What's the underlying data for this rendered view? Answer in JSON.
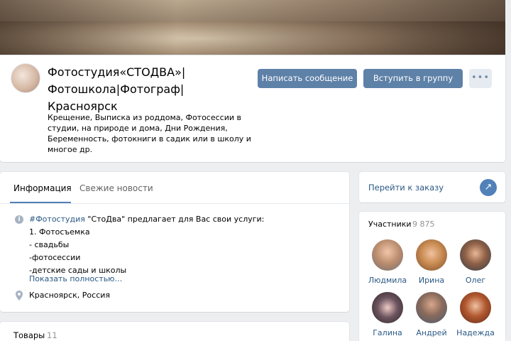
{
  "group": {
    "title": "Фотостудия«СТОДВА»| Фотошкола|Фотограф| Красноярск",
    "status": "Крещение, Выписка из роддома, Фотосессии в студии, на природе и дома, Дни Рождения, Беременность, фотокниги в садик или в школу и многое др."
  },
  "actions": {
    "message_label": "Написать сообщение",
    "join_label": "Вступить в группу",
    "more_label": "•••"
  },
  "tabs": {
    "info_label": "Информация",
    "news_label": "Свежие новости"
  },
  "info": {
    "hashtag": "#Фотостудия",
    "line1_rest": " \"СтоДва\" предлагает для Вас свои услуги:",
    "lines": [
      "1. Фотосъемка",
      "- свадьбы",
      "-фотосессии",
      "-детские сады и школы"
    ],
    "show_more": "Показать полностью…",
    "location": "Красноярск, Россия"
  },
  "goods": {
    "title": "Товары",
    "count": "11"
  },
  "order": {
    "label": "Перейти к заказу"
  },
  "members": {
    "title": "Участники",
    "count": "9 875",
    "people": [
      {
        "name": "Людмила"
      },
      {
        "name": "Ирина"
      },
      {
        "name": "Олег"
      },
      {
        "name": "Галина"
      },
      {
        "name": "Андрей"
      },
      {
        "name": "Надежда"
      }
    ]
  },
  "colors": {
    "accent": "#5181b8",
    "button": "#5e81a8",
    "link": "#2a5885",
    "background": "#edeef0"
  }
}
